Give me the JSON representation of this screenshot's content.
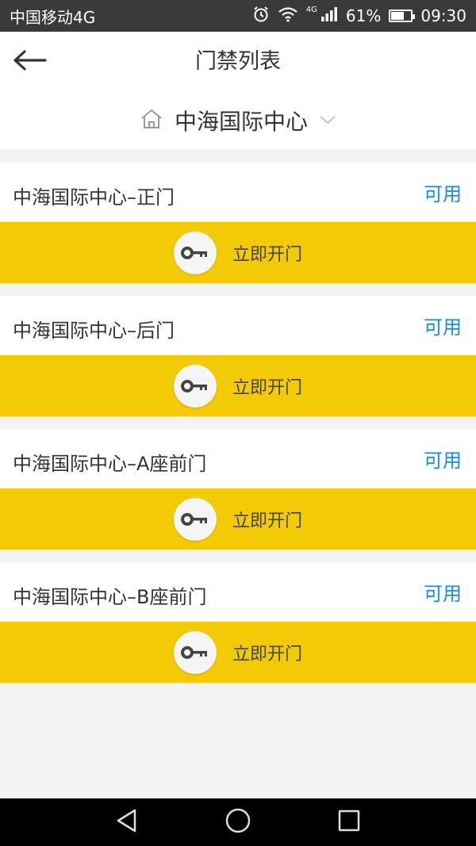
{
  "status_bar": {
    "carrier": "中国移动4G",
    "network": "4G",
    "battery": "61%",
    "battery_level": 0.61,
    "time": "09:30"
  },
  "header": {
    "title": "门禁列表",
    "back_icon": "arrow-left-icon"
  },
  "location": {
    "name": "中海国际中心",
    "icon": "home-icon",
    "dropdown_icon": "chevron-down-icon"
  },
  "doors": [
    {
      "name": "中海国际中心–正门",
      "status": "可用",
      "action": "立即开门"
    },
    {
      "name": "中海国际中心–后门",
      "status": "可用",
      "action": "立即开门"
    },
    {
      "name": "中海国际中心–A座前门",
      "status": "可用",
      "action": "立即开门"
    },
    {
      "name": "中海国际中心–B座前门",
      "status": "可用",
      "action": "立即开门"
    }
  ],
  "colors": {
    "accent_yellow": "#f2ca05",
    "status_blue": "#1a8ae6",
    "status_bar_bg": "#3a3a3a"
  },
  "nav_bar": {
    "back": "triangle-back-icon",
    "home": "circle-home-icon",
    "recent": "square-recent-icon"
  }
}
